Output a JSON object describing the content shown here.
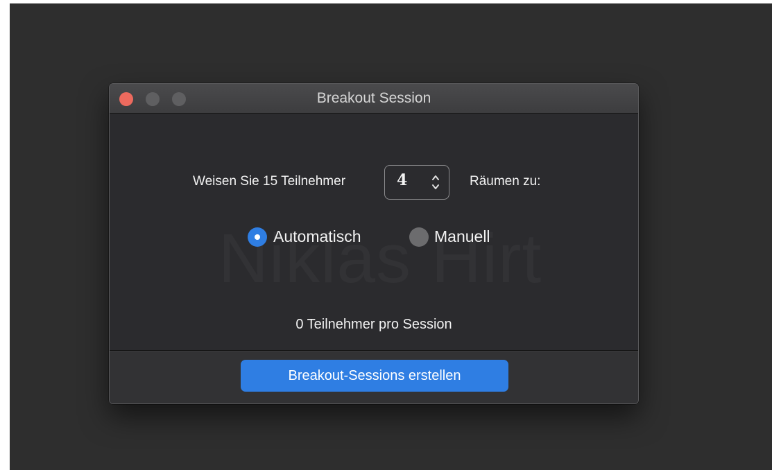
{
  "window": {
    "title": "Breakout Session",
    "watermark": "Niklas Hirt"
  },
  "assign": {
    "prefix": "Weisen Sie 15 Teilnehmer",
    "room_count": "4",
    "suffix": "Räumen zu:"
  },
  "mode": {
    "options": [
      {
        "label": "Automatisch",
        "selected": true
      },
      {
        "label": "Manuell",
        "selected": false
      }
    ]
  },
  "per_session_text": "0 Teilnehmer pro Session",
  "footer": {
    "create_label": "Breakout-Sessions erstellen"
  },
  "colors": {
    "accent": "#2f7ee3",
    "close": "#ed6a5e",
    "window_bg": "#2b2b2e",
    "backdrop": "#2e2e2e"
  },
  "icons": {
    "stepper": "chevron-up-down-icon"
  }
}
